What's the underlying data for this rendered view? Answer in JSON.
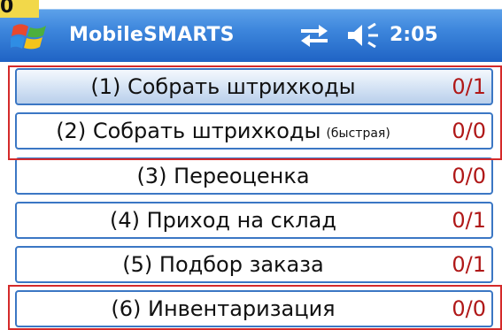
{
  "corner_label": "0",
  "titlebar": {
    "app_title": "MobileSMARTS",
    "clock": "2:05",
    "icons": {
      "start": "windows-flag-icon",
      "network": "connectivity-arrows-icon",
      "volume": "speaker-icon"
    }
  },
  "menu": {
    "items": [
      {
        "label": "(1) Собрать штрихкоды",
        "label_small": "",
        "count": "0/1"
      },
      {
        "label": "(2) Собрать штрихкоды",
        "label_small": "(быстрая)",
        "count": "0/0"
      },
      {
        "label": "(3) Переоценка",
        "label_small": "",
        "count": "0/0"
      },
      {
        "label": "(4) Приход на склад",
        "label_small": "",
        "count": "0/1"
      },
      {
        "label": "(5) Подбор заказа",
        "label_small": "",
        "count": "0/1"
      },
      {
        "label": "(6) Инвентаризация",
        "label_small": "",
        "count": "0/0"
      }
    ]
  },
  "colors": {
    "titlebar": "#3d86dc",
    "item_border": "#3b77c4",
    "count_text": "#b01818",
    "annotation": "#d42a2a",
    "corner_tab": "#f2d84a"
  }
}
